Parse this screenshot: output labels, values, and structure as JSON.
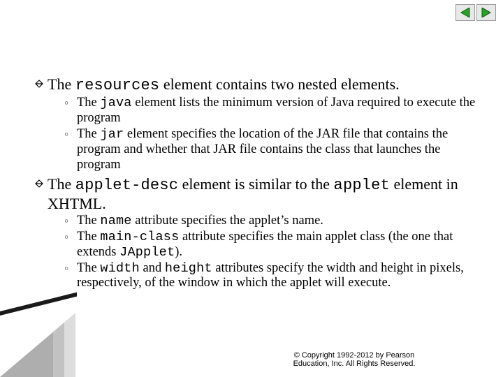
{
  "nav": {
    "prev_icon": "triangle-left",
    "next_icon": "triangle-right"
  },
  "bullets": [
    {
      "main": [
        {
          "t": "The "
        },
        {
          "t": "resources",
          "mono": true
        },
        {
          "t": " element contains two nested elements."
        }
      ],
      "subs": [
        [
          {
            "t": "The "
          },
          {
            "t": "java",
            "mono": true
          },
          {
            "t": " element lists the minimum version of Java required to execute the program"
          }
        ],
        [
          {
            "t": "The "
          },
          {
            "t": "jar",
            "mono": true
          },
          {
            "t": " element specifies the location of the JAR file that contains the program and whether that JAR file contains the class that launches the program"
          }
        ]
      ]
    },
    {
      "main": [
        {
          "t": "The "
        },
        {
          "t": "applet-desc",
          "mono": true
        },
        {
          "t": " element is similar to the "
        },
        {
          "t": "applet",
          "mono": true
        },
        {
          "t": " element in XHTML."
        }
      ],
      "subs": [
        [
          {
            "t": "The "
          },
          {
            "t": "name",
            "mono": true
          },
          {
            "t": " attribute specifies the applet’s name."
          }
        ],
        [
          {
            "t": "The "
          },
          {
            "t": "main-class",
            "mono": true
          },
          {
            "t": " attribute specifies the main applet class (the one that extends "
          },
          {
            "t": "JApplet",
            "mono": true
          },
          {
            "t": ")."
          }
        ],
        [
          {
            "t": "The "
          },
          {
            "t": "width",
            "mono": true
          },
          {
            "t": " and "
          },
          {
            "t": "height",
            "mono": true
          },
          {
            "t": " attributes specify the width and height in pixels, respectively, of the window in which the applet will execute."
          }
        ]
      ]
    }
  ],
  "copyright": {
    "line1": "© Copyright 1992-2012 by Pearson",
    "line2": "Education, Inc. All Rights Reserved."
  }
}
